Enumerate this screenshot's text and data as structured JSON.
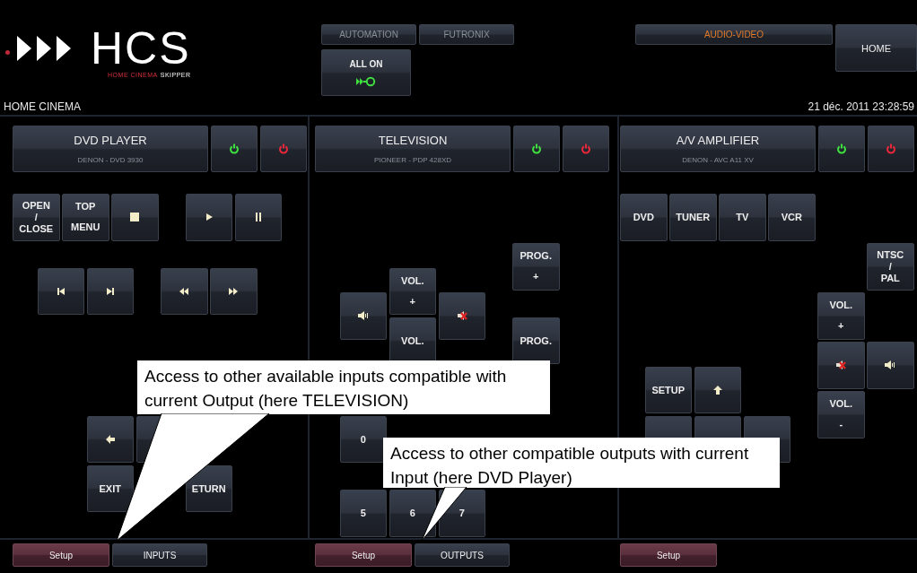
{
  "logo": {
    "mark": "HCS",
    "tagline_colored": "HOME CINEMA",
    "tagline": "SKIPPER"
  },
  "nav": [
    {
      "label": "AUTOMATION",
      "selected": false
    },
    {
      "label": "FUTRONIX",
      "selected": false
    }
  ],
  "all_on": {
    "label": "ALL ON"
  },
  "section": {
    "label": "AUDIO-VIDEO",
    "selected": true
  },
  "home": {
    "label": "HOME"
  },
  "location": "HOME CINEMA",
  "datetime": "21 déc. 2011 23:28:59",
  "panels": [
    {
      "title": "DVD PLAYER",
      "model": "DENON - DVD 3930",
      "buttons": [
        {
          "kind": "text",
          "label": "OPEN\n/\nCLOSE"
        },
        {
          "kind": "text",
          "label": "TOP\nMENU"
        },
        {
          "kind": "stop"
        },
        {
          "kind": "play"
        },
        {
          "kind": "pause"
        },
        {
          "kind": "prev"
        },
        {
          "kind": "next"
        },
        {
          "kind": "rewind"
        },
        {
          "kind": "forward"
        },
        {
          "kind": "left"
        },
        {
          "kind": "blank"
        },
        {
          "kind": "text",
          "label": "EXIT"
        },
        {
          "kind": "text",
          "label": "ETURN"
        }
      ],
      "footer": [
        {
          "kind": "setup",
          "label": "Setup"
        },
        {
          "kind": "link",
          "label": "INPUTS"
        }
      ]
    },
    {
      "title": "TELEVISION",
      "model": "PIONEER - PDP 428XD",
      "buttons": [
        {
          "kind": "text",
          "label": "PROG.\n+"
        },
        {
          "kind": "text",
          "label": "VOL.\n+"
        },
        {
          "kind": "speaker"
        },
        {
          "kind": "mute"
        },
        {
          "kind": "text",
          "label": "VOL."
        },
        {
          "kind": "text",
          "label": "PROG."
        },
        {
          "kind": "text",
          "label": "0"
        },
        {
          "kind": "text",
          "label": "5"
        },
        {
          "kind": "text",
          "label": "6"
        },
        {
          "kind": "text",
          "label": "7"
        }
      ],
      "footer": [
        {
          "kind": "setup",
          "label": "Setup"
        },
        {
          "kind": "link",
          "label": "OUTPUTS"
        }
      ]
    },
    {
      "title": "A/V AMPLIFIER",
      "model": "DENON - AVC A11 XV",
      "buttons": [
        {
          "kind": "text",
          "label": "DVD"
        },
        {
          "kind": "text",
          "label": "TUNER"
        },
        {
          "kind": "text",
          "label": "TV"
        },
        {
          "kind": "text",
          "label": "VCR"
        },
        {
          "kind": "text",
          "label": "NTSC\n/\nPAL"
        },
        {
          "kind": "text",
          "label": "VOL.\n+"
        },
        {
          "kind": "mute"
        },
        {
          "kind": "speaker"
        },
        {
          "kind": "text",
          "label": "SETUP"
        },
        {
          "kind": "up"
        },
        {
          "kind": "text",
          "label": "VOL.\n-"
        },
        {
          "kind": "blank"
        },
        {
          "kind": "blank"
        },
        {
          "kind": "blank"
        }
      ],
      "footer": [
        {
          "kind": "setup",
          "label": "Setup"
        }
      ]
    }
  ],
  "callouts": [
    {
      "text": "Access to other available inputs compatible with current Output (here TELEVISION)"
    },
    {
      "text": "Access to other compatible outputs with current Input (here DVD Player)"
    }
  ]
}
